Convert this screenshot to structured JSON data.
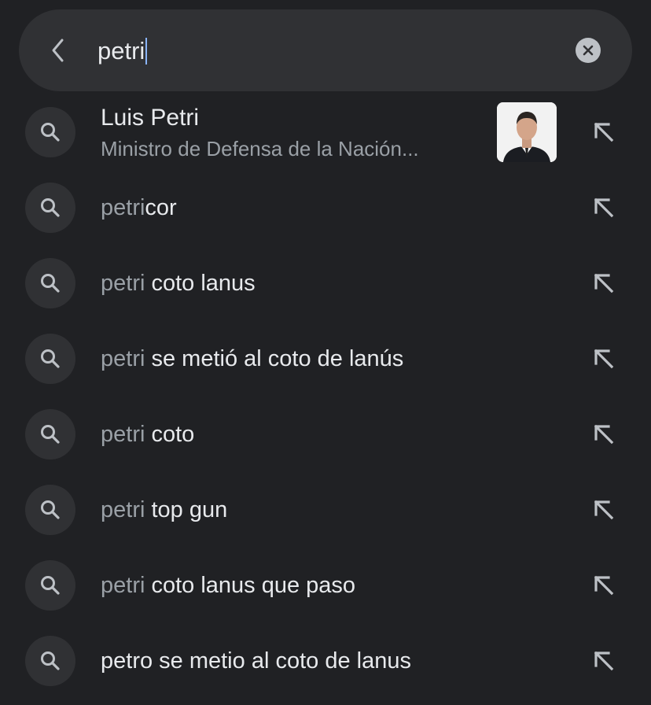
{
  "search": {
    "query": "petri",
    "back_icon": "chevron-left-icon",
    "clear_icon": "close-circle-icon"
  },
  "entity_suggestion": {
    "title": "Luis Petri",
    "subtitle": "Ministro de Defensa de la Nación...",
    "image": "portrait-photo"
  },
  "suggestions": [
    {
      "prefix": "petri",
      "suffix": "cor"
    },
    {
      "prefix": "petri",
      "suffix": " coto lanus"
    },
    {
      "prefix": "petri",
      "suffix": " se metió al coto de lanús"
    },
    {
      "prefix": "petri",
      "suffix": " coto"
    },
    {
      "prefix": "petri",
      "suffix": " top gun"
    },
    {
      "prefix": "petri",
      "suffix": " coto lanus que paso"
    },
    {
      "prefix": "",
      "suffix": "petro se metio al coto de lanus"
    }
  ],
  "colors": {
    "background": "#202124",
    "surface": "#303134",
    "primary_text": "#e8eaed",
    "secondary_text": "#9aa0a6",
    "caret": "#8ab4f8"
  }
}
